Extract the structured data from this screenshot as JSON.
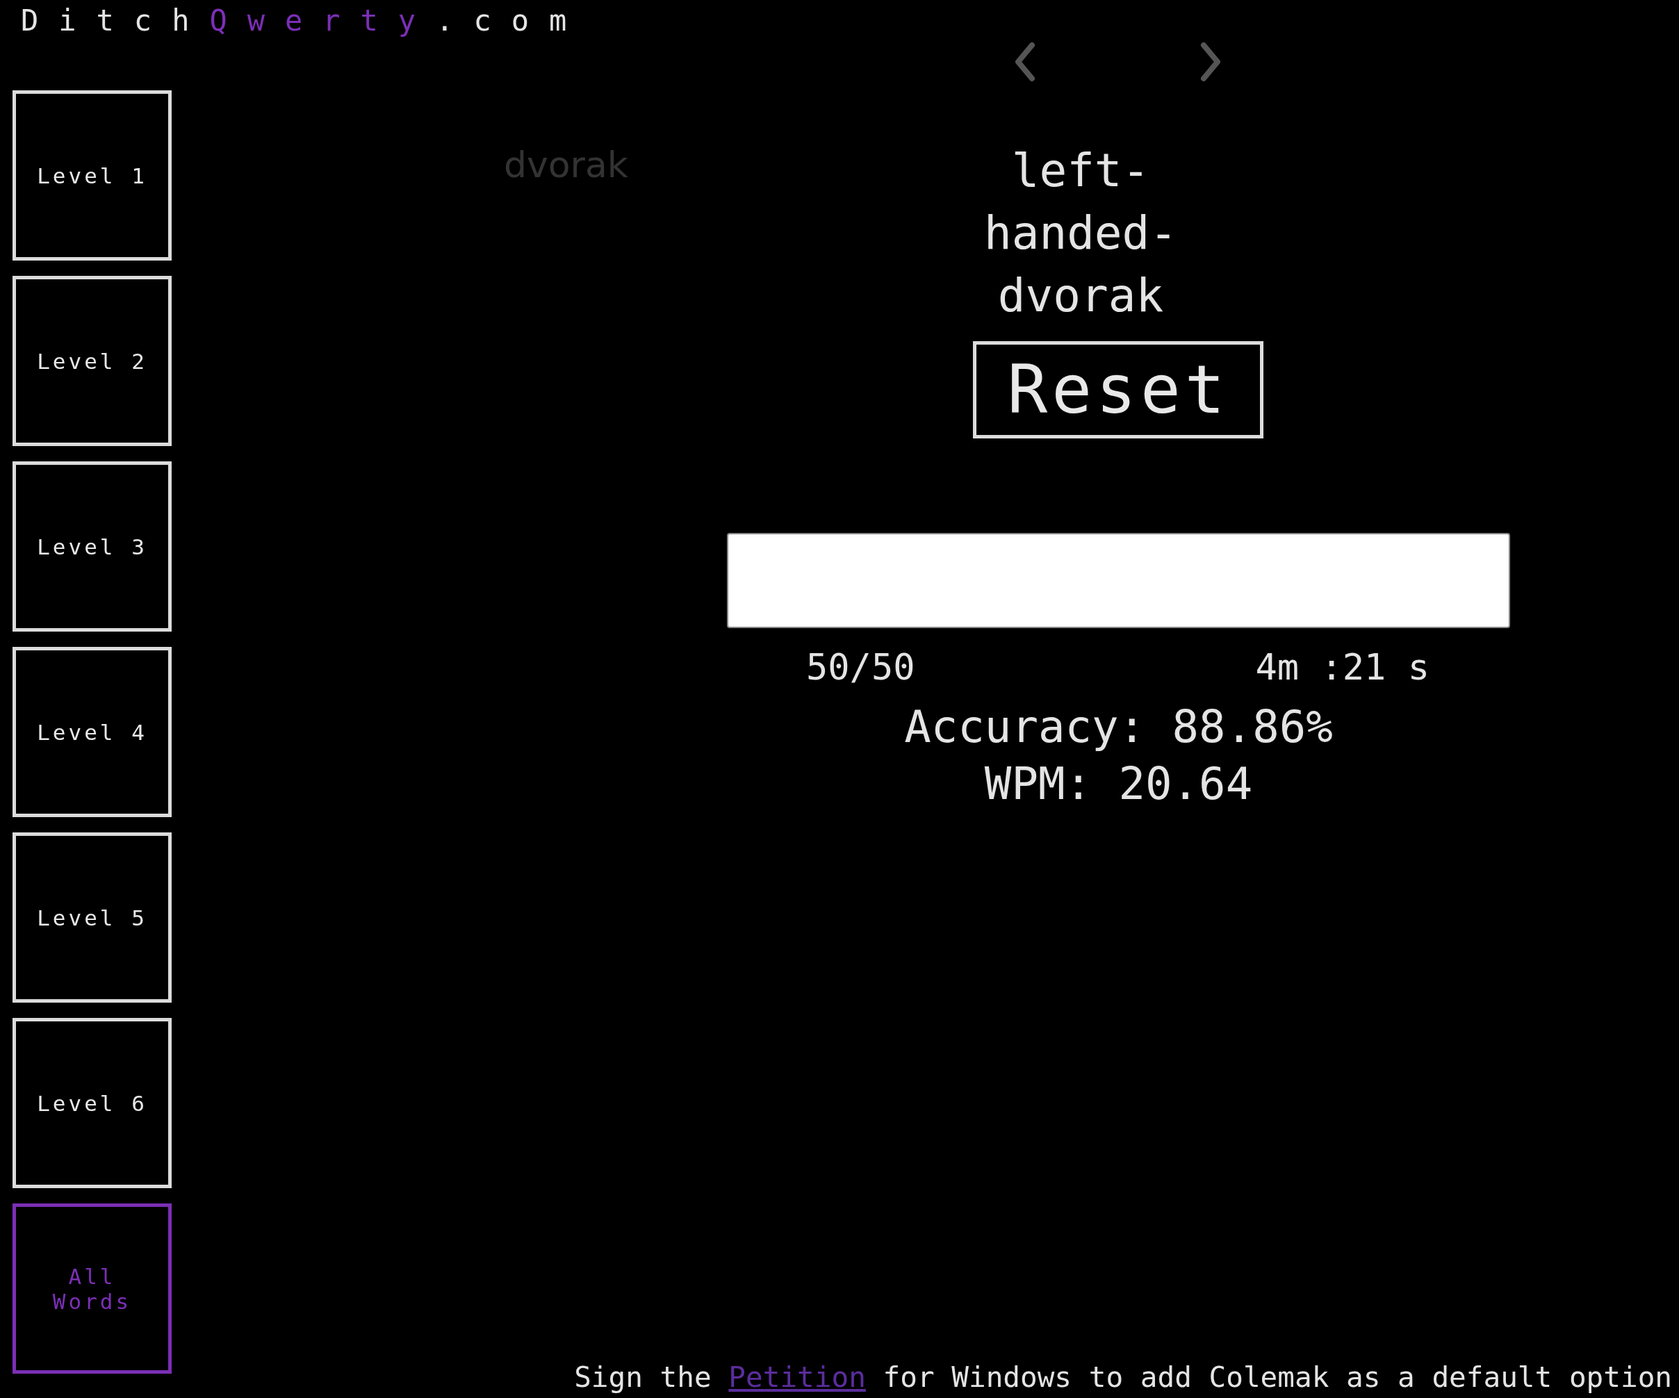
{
  "logo": [
    {
      "text": "Ditch",
      "accent": false
    },
    {
      "text": "Qwerty",
      "accent": true
    },
    {
      "text": ".com",
      "accent": false
    }
  ],
  "levels": [
    {
      "label": "Level 1",
      "selected": false
    },
    {
      "label": "Level 2",
      "selected": false
    },
    {
      "label": "Level 3",
      "selected": false
    },
    {
      "label": "Level 4",
      "selected": false
    },
    {
      "label": "Level 5",
      "selected": false
    },
    {
      "label": "Level 6",
      "selected": false
    },
    {
      "label": "All Words",
      "selected": true
    }
  ],
  "layout_carousel": {
    "previous": "dvorak",
    "current": "left-handed-dvorak"
  },
  "reset_button": "Reset",
  "progress": "50/50",
  "timer": "4m :21 s",
  "accuracy": "Accuracy: 88.86%",
  "wpm": "WPM: 20.64",
  "footer": {
    "before": "Sign the",
    "link": "Petition",
    "after": "for Windows to add Colemak as a default option"
  }
}
